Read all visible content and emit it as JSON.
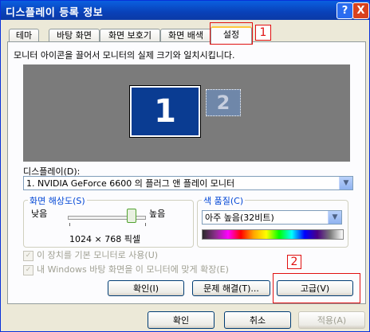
{
  "window": {
    "title": "디스플레이 등록 정보",
    "help_label": "?",
    "close_label": "X"
  },
  "tabs": [
    {
      "label": "테마"
    },
    {
      "label": "바탕 화면"
    },
    {
      "label": "화면 보호기"
    },
    {
      "label": "화면 배색"
    },
    {
      "label": "설정"
    }
  ],
  "settings": {
    "description": "모니터 아이콘을 끌어서 모니터의 실제 크기와 일치시킵니다.",
    "monitor_primary": "1",
    "monitor_secondary": "2",
    "display_label": "디스플레이(D):",
    "display_value": "1. NVIDIA GeForce 6600 의 플러그 앤 플레이 모니터",
    "resolution": {
      "title": "화면 해상도(S)",
      "low": "낮음",
      "high": "높음",
      "value": "1024 × 768 픽셀",
      "level": 1.0
    },
    "color_quality": {
      "title": "색 품질(C)",
      "value": "아주 높음(32비트)"
    },
    "primary_checkbox": "이 장치를 기본 모니터로 사용(U)",
    "extend_checkbox": "내 Windows 바탕 화면을 이 모니터에 맞게 확장(E)",
    "identify_button": "확인(I)",
    "troubleshoot_button": "문제 해결(T)...",
    "advanced_button": "고급(V)"
  },
  "footer": {
    "ok": "확인",
    "cancel": "취소",
    "apply": "적용(A)"
  },
  "annotations": {
    "marker1": "1",
    "marker2": "2",
    "color": "#e01010"
  }
}
